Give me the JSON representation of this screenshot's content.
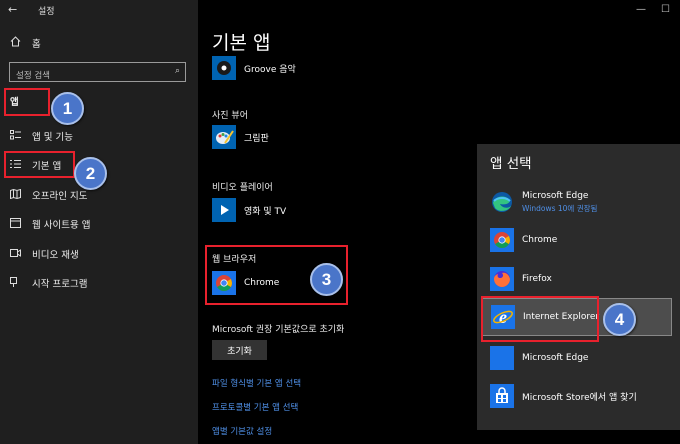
{
  "window": {
    "title": "설정",
    "back_icon": "back-arrow-icon"
  },
  "sidebar": {
    "home_label": "홈",
    "search_placeholder": "설정 검색",
    "category": "앱",
    "items": [
      {
        "label": "앱 및 기능",
        "icon": "apps-list-icon"
      },
      {
        "label": "기본 앱",
        "icon": "default-apps-icon"
      },
      {
        "label": "오프라인 지도",
        "icon": "map-icon"
      },
      {
        "label": "웹 사이트용 앱",
        "icon": "website-apps-icon"
      },
      {
        "label": "비디오 재생",
        "icon": "video-icon"
      },
      {
        "label": "시작 프로그램",
        "icon": "startup-icon"
      }
    ]
  },
  "main": {
    "title": "기본 앱",
    "music_app": "Groove 음악",
    "photo_section": "사진 뷰어",
    "photo_app": "그림판",
    "video_section": "비디오 플레이어",
    "video_app": "영화 및 TV",
    "browser_section": "웹 브라우저",
    "browser_app": "Chrome",
    "reset_label": "Microsoft 권장 기본값으로 초기화",
    "reset_button": "초기화",
    "links": [
      "파일 형식별 기본 앱 선택",
      "프로토콜별 기본 앱 선택",
      "앱별 기본값 설정"
    ]
  },
  "chooser": {
    "title": "앱 선택",
    "items": [
      {
        "name": "Microsoft Edge",
        "sub": "Windows 10에 권장됨",
        "icon": "edge-new-icon"
      },
      {
        "name": "Chrome",
        "sub": "",
        "icon": "chrome-icon"
      },
      {
        "name": "Firefox",
        "sub": "",
        "icon": "firefox-icon"
      },
      {
        "name": "Internet Explorer",
        "sub": "",
        "icon": "internet-explorer-icon"
      },
      {
        "name": "Microsoft Edge",
        "sub": "",
        "icon": "edge-legacy-icon"
      },
      {
        "name": "Microsoft Store에서 앱 찾기",
        "sub": "",
        "icon": "store-icon"
      }
    ]
  },
  "annotations": [
    "1",
    "2",
    "3",
    "4"
  ],
  "colors": {
    "highlight_red": "#e8212d",
    "badge_blue": "#4a75c9",
    "link_blue": "#4f8fe6",
    "sidebar_bg": "#1f1f1f",
    "panel_bg": "#2b2b2b"
  }
}
